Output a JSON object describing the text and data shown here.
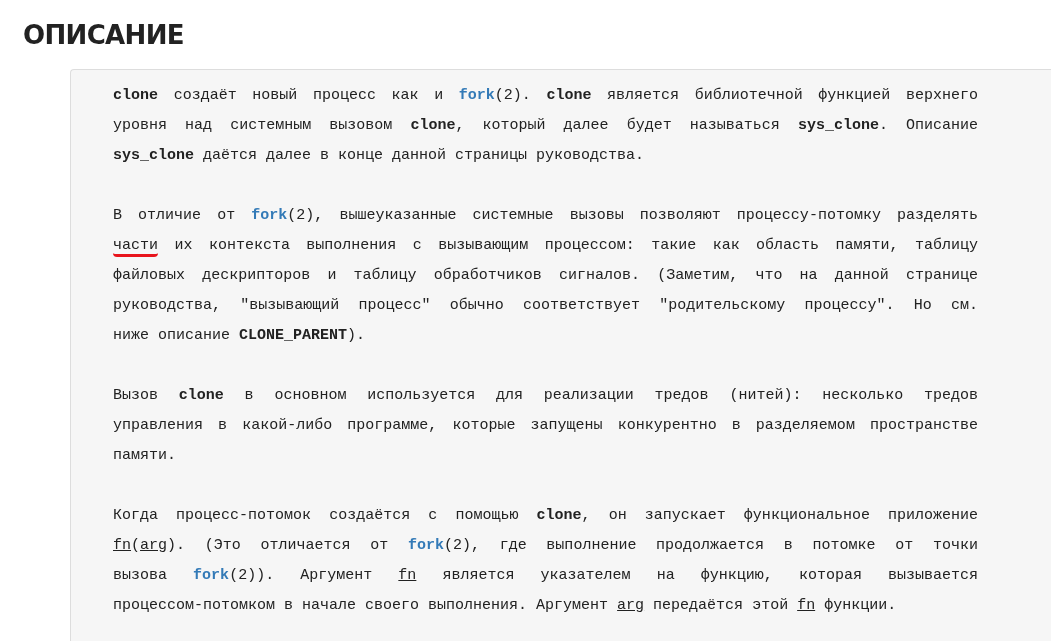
{
  "heading": "ОПИСАНИЕ",
  "paragraphs": [
    {
      "lines": [
        [
          {
            "kind": "bold",
            "text": "clone"
          },
          {
            "kind": "plain",
            "text": " создаёт новый процесс как и "
          },
          {
            "kind": "link",
            "text": "fork"
          },
          {
            "kind": "plain",
            "text": "(2). "
          },
          {
            "kind": "bold",
            "text": "clone"
          },
          {
            "kind": "plain",
            "text": " является библиотечной функцией верхнего"
          }
        ],
        [
          {
            "kind": "plain",
            "text": "уровня над системным вызовом "
          },
          {
            "kind": "bold",
            "text": "clone"
          },
          {
            "kind": "plain",
            "text": ", который далее будет называться "
          },
          {
            "kind": "bold",
            "text": "sys_clone"
          },
          {
            "kind": "plain",
            "text": ". Описание"
          }
        ],
        [
          {
            "kind": "bold",
            "text": "sys_clone"
          },
          {
            "kind": "plain",
            "text": " даётся далее в конце данной страницы руководства."
          }
        ]
      ]
    },
    {
      "lines": [
        [
          {
            "kind": "plain",
            "text": "В отличие от "
          },
          {
            "kind": "link",
            "text": "fork"
          },
          {
            "kind": "plain",
            "text": "(2), вышеуказанные системные вызовы позволяют процессу-потомку разделять"
          }
        ],
        [
          {
            "kind": "marked",
            "text": "части"
          },
          {
            "kind": "plain",
            "text": " их контекста выполнения с вызывающим процессом: такие как область памяти, таблицу"
          }
        ],
        [
          {
            "kind": "plain",
            "text": "файловых дескрипторов и таблицу обработчиков сигналов. (Заметим, что на данной странице"
          }
        ],
        [
          {
            "kind": "plain",
            "text": "руководства, \"вызывающий процесс\" обычно соответствует \"родительскому процессу\". Но см."
          }
        ],
        [
          {
            "kind": "plain",
            "text": "ниже описание "
          },
          {
            "kind": "bold",
            "text": "CLONE_PARENT"
          },
          {
            "kind": "plain",
            "text": ")."
          }
        ]
      ]
    },
    {
      "lines": [
        [
          {
            "kind": "plain",
            "text": "Вызов "
          },
          {
            "kind": "bold",
            "text": "clone"
          },
          {
            "kind": "plain",
            "text": " в основном используется для реализации тредов (нитей): несколько тредов"
          }
        ],
        [
          {
            "kind": "plain",
            "text": "управления в какой-либо программе, которые запущены конкурентно в разделяемом пространстве"
          }
        ],
        [
          {
            "kind": "plain",
            "text": "памяти."
          }
        ]
      ]
    },
    {
      "lines": [
        [
          {
            "kind": "plain",
            "text": "Когда процесс-потомок создаётся с помощью "
          },
          {
            "kind": "bold",
            "text": "clone"
          },
          {
            "kind": "plain",
            "text": ", он запускает функциональное приложение"
          }
        ],
        [
          {
            "kind": "underline",
            "text": "fn"
          },
          {
            "kind": "plain",
            "text": "("
          },
          {
            "kind": "underline",
            "text": "arg"
          },
          {
            "kind": "plain",
            "text": "). (Это отличается от "
          },
          {
            "kind": "link",
            "text": "fork"
          },
          {
            "kind": "plain",
            "text": "(2), где выполнение продолжается в потомке от точки"
          }
        ],
        [
          {
            "kind": "plain",
            "text": "вызова "
          },
          {
            "kind": "link",
            "text": "fork"
          },
          {
            "kind": "plain",
            "text": "(2)). Аргумент "
          },
          {
            "kind": "underline",
            "text": "fn"
          },
          {
            "kind": "plain",
            "text": " является указателем на функцию, которая вызывается"
          }
        ],
        [
          {
            "kind": "plain",
            "text": "процессом-потомком в начале своего выполнения. Аргумент "
          },
          {
            "kind": "underline",
            "text": "arg"
          },
          {
            "kind": "plain",
            "text": " передаётся этой "
          },
          {
            "kind": "underline",
            "text": "fn"
          },
          {
            "kind": "plain",
            "text": " функции."
          }
        ]
      ]
    }
  ]
}
